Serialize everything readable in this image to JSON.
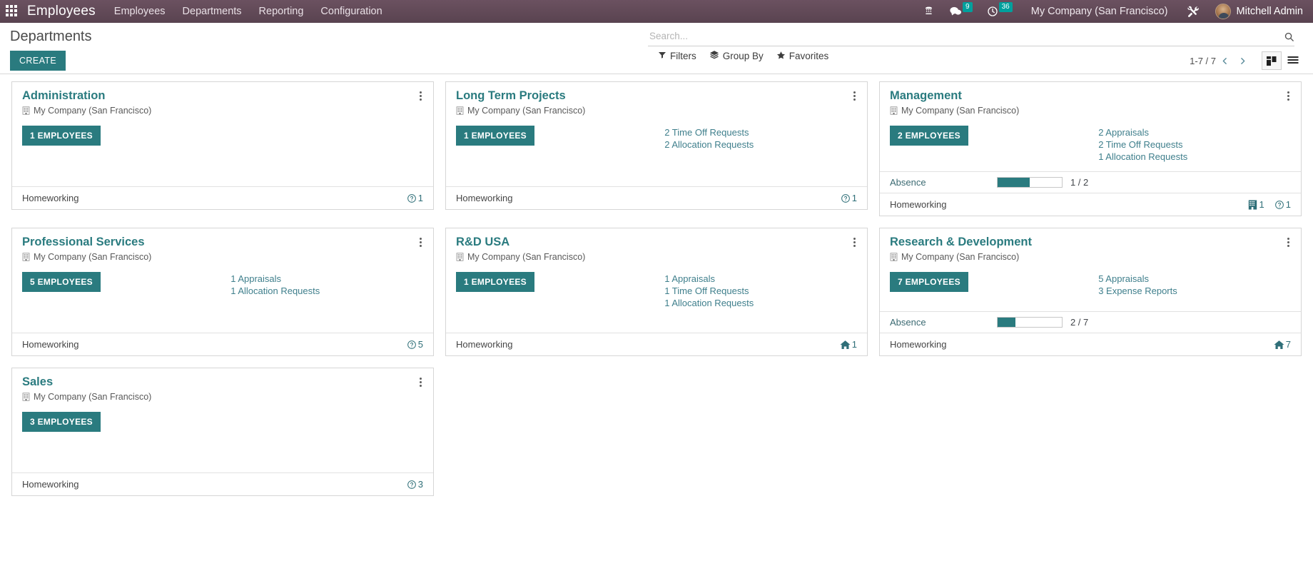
{
  "topbar": {
    "apps_icon": "apps-grid-icon",
    "brand": "Employees",
    "menu": [
      {
        "label": "Employees"
      },
      {
        "label": "Departments"
      },
      {
        "label": "Reporting"
      },
      {
        "label": "Configuration"
      }
    ],
    "voip_icon": "phone-keypad-icon",
    "messages_icon": "chat-bubble-icon",
    "messages_count": "9",
    "activities_icon": "clock-icon",
    "activities_count": "36",
    "company": "My Company (San Francisco)",
    "tools_icon": "wrench-screwdriver-icon",
    "avatar": "user-avatar",
    "user": "Mitchell Admin",
    "accent_badge_color": "#00a09d",
    "bar_color": "#5c4452"
  },
  "control_panel": {
    "title": "Departments",
    "create_label": "CREATE",
    "search": {
      "placeholder": "Search...",
      "value": "",
      "icon": "search-icon"
    },
    "filters": [
      {
        "label": "Filters",
        "icon": "funnel-icon"
      },
      {
        "label": "Group By",
        "icon": "layers-icon"
      },
      {
        "label": "Favorites",
        "icon": "star-icon"
      }
    ],
    "pager": "1-7 / 7",
    "prev_icon": "chevron-left-icon",
    "next_icon": "chevron-right-icon",
    "views": [
      {
        "name": "kanban",
        "icon": "kanban-view-icon",
        "active": true
      },
      {
        "name": "list",
        "icon": "list-view-icon",
        "active": false
      }
    ]
  },
  "kanban": {
    "company_icon": "building-icon",
    "footer_label": "Homeworking",
    "absence_label": "Absence",
    "accent_color": "#2a7b7f",
    "cards": [
      {
        "title": "Administration",
        "company": "My Company (San Francisco)",
        "employees_button": "1 EMPLOYEES",
        "stats": [],
        "absence": null,
        "footer_label": "Homeworking",
        "footer_icons": [
          {
            "icon": "question-circle-icon",
            "count": "1"
          }
        ]
      },
      {
        "title": "Long Term Projects",
        "company": "My Company (San Francisco)",
        "employees_button": "1 EMPLOYEES",
        "stats": [
          {
            "label": "2 Time Off Requests"
          },
          {
            "label": "2 Allocation Requests"
          }
        ],
        "absence": null,
        "footer_label": "Homeworking",
        "footer_icons": [
          {
            "icon": "question-circle-icon",
            "count": "1"
          }
        ]
      },
      {
        "title": "Management",
        "company": "My Company (San Francisco)",
        "employees_button": "2 EMPLOYEES",
        "stats": [
          {
            "label": "2 Appraisals"
          },
          {
            "label": "2 Time Off Requests"
          },
          {
            "label": "1 Allocation Requests"
          }
        ],
        "absence": {
          "label": "Absence",
          "value": "1 / 2",
          "percent": 50
        },
        "footer_label": "Homeworking",
        "footer_icons": [
          {
            "icon": "office-building-icon",
            "count": "1"
          },
          {
            "icon": "question-circle-icon",
            "count": "1"
          }
        ]
      },
      {
        "title": "Professional Services",
        "company": "My Company (San Francisco)",
        "employees_button": "5 EMPLOYEES",
        "stats": [
          {
            "label": "1 Appraisals"
          },
          {
            "label": "1 Allocation Requests"
          }
        ],
        "absence": null,
        "footer_label": "Homeworking",
        "footer_icons": [
          {
            "icon": "question-circle-icon",
            "count": "5"
          }
        ]
      },
      {
        "title": "R&D USA",
        "company": "My Company (San Francisco)",
        "employees_button": "1 EMPLOYEES",
        "stats": [
          {
            "label": "1 Appraisals"
          },
          {
            "label": "1 Time Off Requests"
          },
          {
            "label": "1 Allocation Requests"
          }
        ],
        "absence": null,
        "footer_label": "Homeworking",
        "footer_icons": [
          {
            "icon": "home-icon",
            "count": "1"
          }
        ]
      },
      {
        "title": "Research & Development",
        "company": "My Company (San Francisco)",
        "employees_button": "7 EMPLOYEES",
        "stats": [
          {
            "label": "5 Appraisals"
          },
          {
            "label": "3 Expense Reports"
          }
        ],
        "absence": {
          "label": "Absence",
          "value": "2 / 7",
          "percent": 28
        },
        "footer_label": "Homeworking",
        "footer_icons": [
          {
            "icon": "home-icon",
            "count": "7"
          }
        ]
      },
      {
        "title": "Sales",
        "company": "My Company (San Francisco)",
        "employees_button": "3 EMPLOYEES",
        "stats": [],
        "absence": null,
        "footer_label": "Homeworking",
        "footer_icons": [
          {
            "icon": "question-circle-icon",
            "count": "3"
          }
        ]
      }
    ]
  }
}
